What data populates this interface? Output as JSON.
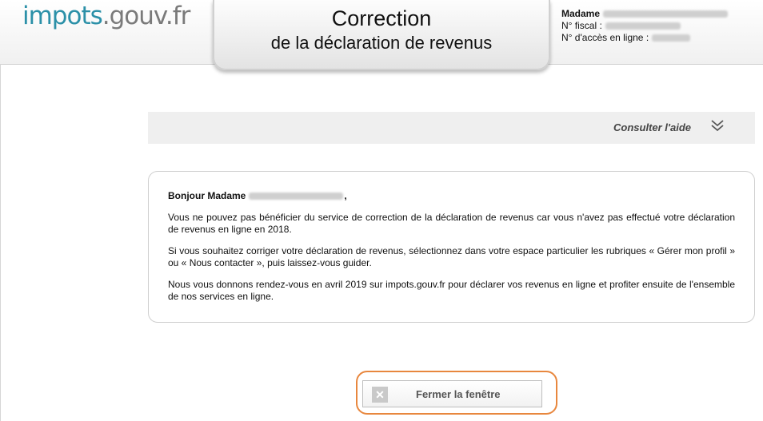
{
  "logo": {
    "part1": "impots",
    "part2": ".gouv.fr"
  },
  "title": {
    "line1": "Correction",
    "line2": "de la déclaration de revenus"
  },
  "user": {
    "name_label": "Madame",
    "fiscal_label": "N° fiscal :",
    "access_label": "N° d'accès en ligne :"
  },
  "help": {
    "label": "Consulter l'aide",
    "icon": "chevron-double-down-icon"
  },
  "message": {
    "greeting": "Bonjour Madame",
    "greeting_suffix": ",",
    "p1": "Vous ne pouvez pas bénéficier du service de correction de la déclaration de revenus car vous n'avez pas effectué votre déclaration de revenus en ligne en 2018.",
    "p2": "Si vous souhaitez corriger votre déclaration de revenus, sélectionnez dans votre espace particulier les rubriques « Gérer mon profil » ou « Nous contacter », puis laissez-vous guider.",
    "p3": "Nous vous donnons rendez-vous en avril 2019 sur impots.gouv.fr pour déclarer vos revenus en ligne et profiter ensuite de l'ensemble de nos services en ligne."
  },
  "close_button": {
    "label": "Fermer la fenêtre",
    "icon": "close-icon"
  },
  "colors": {
    "brand_teal": "#2b90a8",
    "highlight_orange": "#e8873e"
  }
}
